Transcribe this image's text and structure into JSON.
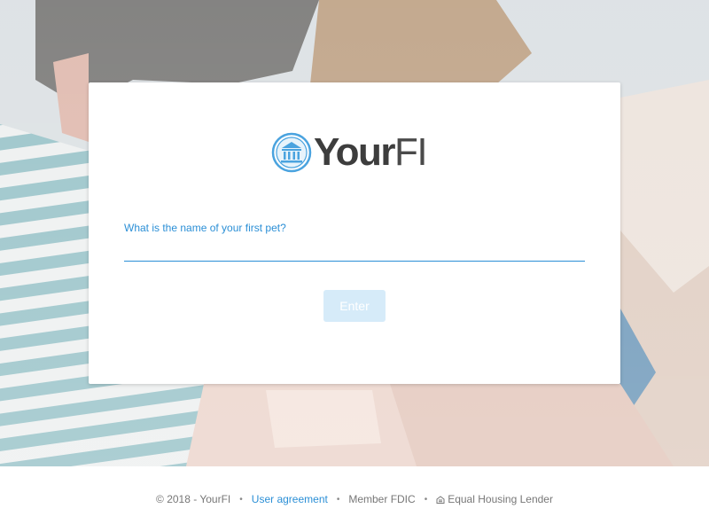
{
  "brand": {
    "name_bold": "Your",
    "name_light": "FI",
    "accent_color": "#2b8fd6",
    "logo_icon": "bank-building-icon"
  },
  "form": {
    "question_label": "What is the name of your first pet?",
    "answer_value": "",
    "answer_placeholder": "",
    "enter_label": "Enter"
  },
  "footer": {
    "copyright": "© 2018 - YourFI",
    "user_agreement": "User agreement",
    "member_fdic": "Member FDIC",
    "equal_housing": "Equal Housing Lender",
    "equal_housing_icon": "house-icon",
    "separator": "•"
  }
}
